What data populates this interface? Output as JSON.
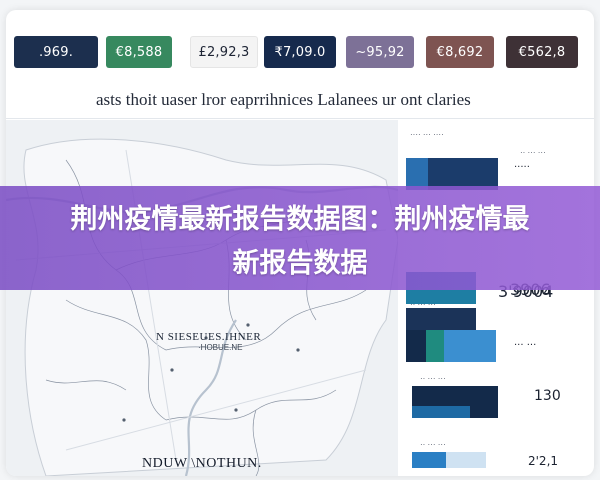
{
  "kpis": [
    {
      "value": ".969."
    },
    {
      "value": "€8,588"
    },
    {
      "value": "£2,92,3"
    },
    {
      "value": "₹7,09.0"
    },
    {
      "value": "~95,92"
    },
    {
      "value": "€8,692"
    },
    {
      "value": "€562,8"
    }
  ],
  "subtitle": "asts thoit uaser lror eaprrihnices Lalanees ur ont claries",
  "map": {
    "label_top": "N SIESEUES.IHNER",
    "label_top_sub": "·HOBUE.NE",
    "label_bottom": "NDUW \\NOTHUN."
  },
  "right_panel": {
    "header": "···· ··· ····",
    "items": [
      {
        "label": "·· ··· ···",
        "value": "·····"
      },
      {
        "label": "·· ··· ···",
        "value": "3906"
      },
      {
        "label": "·· ··· ···",
        "value": "3'9004"
      },
      {
        "label": "·· ··· ···",
        "value": "··· ···"
      },
      {
        "label": "·· ··· ···",
        "value": "130"
      },
      {
        "label": "·· ··· ···",
        "value": "2'2,1"
      }
    ]
  },
  "banner": {
    "title": "荆州疫情最新报告数据图：荆州疫情最新报告数据"
  },
  "colors": {
    "banner": "#8a52cc",
    "navy": "#132a4a",
    "teal": "#1f8b7f",
    "blue": "#3b8fd0"
  }
}
